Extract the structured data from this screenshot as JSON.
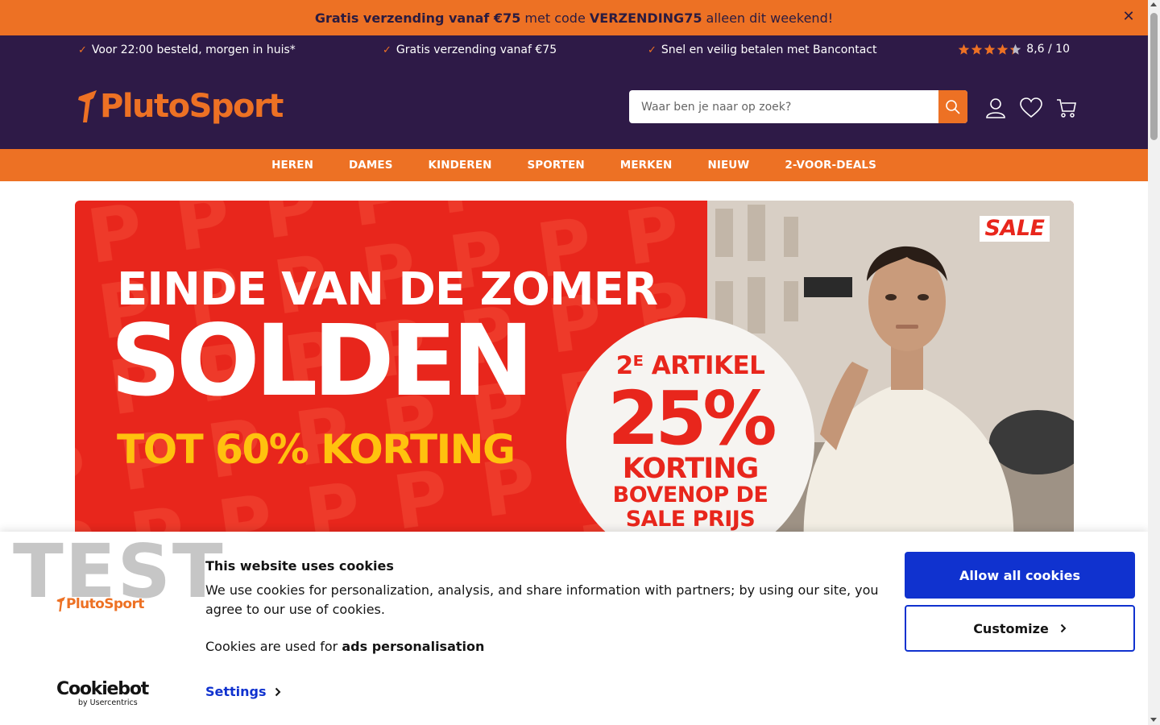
{
  "promo": {
    "part1_bold": "Gratis verzending vanaf €75",
    "part2": " met code ",
    "part3_bold": "VERZENDING75",
    "part4": " alleen dit weekend!",
    "close_icon": "close-icon"
  },
  "usps": [
    {
      "check": "✓",
      "text": "Voor 22:00 besteld, morgen in huis*"
    },
    {
      "check": "✓",
      "text": "Gratis verzending vanaf €75"
    },
    {
      "check": "✓",
      "text": "Snel en veilig betalen met Bancontact"
    }
  ],
  "rating": {
    "value": 4.3,
    "max_stars": 5,
    "label": "8,6 / 10"
  },
  "logo": {
    "text": "PlutoSport"
  },
  "search": {
    "placeholder": "Waar ben je naar op zoek?",
    "value": ""
  },
  "header_icons": [
    "account-icon",
    "heart-icon",
    "cart-icon"
  ],
  "nav": {
    "items": [
      "HEREN",
      "DAMES",
      "KINDEREN",
      "SPORTEN",
      "MERKEN",
      "NIEUW",
      "2-VOOR-DEALS"
    ]
  },
  "hero": {
    "line1": "EINDE VAN DE ZOMER",
    "line2": "SOLDEN",
    "line3": "TOT 60% KORTING",
    "badge": "SALE",
    "circle_line1": "2ᴱ ARTIKEL",
    "circle_line2": "25%",
    "circle_line3": "KORTING",
    "circle_line4a": "BOVENOP DE",
    "circle_line4b": "SALE PRIJS"
  },
  "cookie": {
    "watermark": "TEST",
    "logo_text": "PlutoSport",
    "title": "This website uses cookies",
    "body": "We use cookies for personalization, analysis, and share information with partners; by using our site, you agree to our use of cookies.",
    "purpose_prefix": "Cookies are used for ",
    "purpose_bold": "ads personalisation",
    "settings_label": "Settings",
    "allow_label": "Allow all cookies",
    "customize_label": "Customize",
    "cookiebot_main": "Cookiebot",
    "cookiebot_sub": "by Usercentrics"
  },
  "colors": {
    "orange": "#ed7124",
    "purple": "#2e1a47",
    "hero_red": "#e8261c",
    "yellow": "#ffc20e",
    "cookie_blue": "#1032cf"
  }
}
